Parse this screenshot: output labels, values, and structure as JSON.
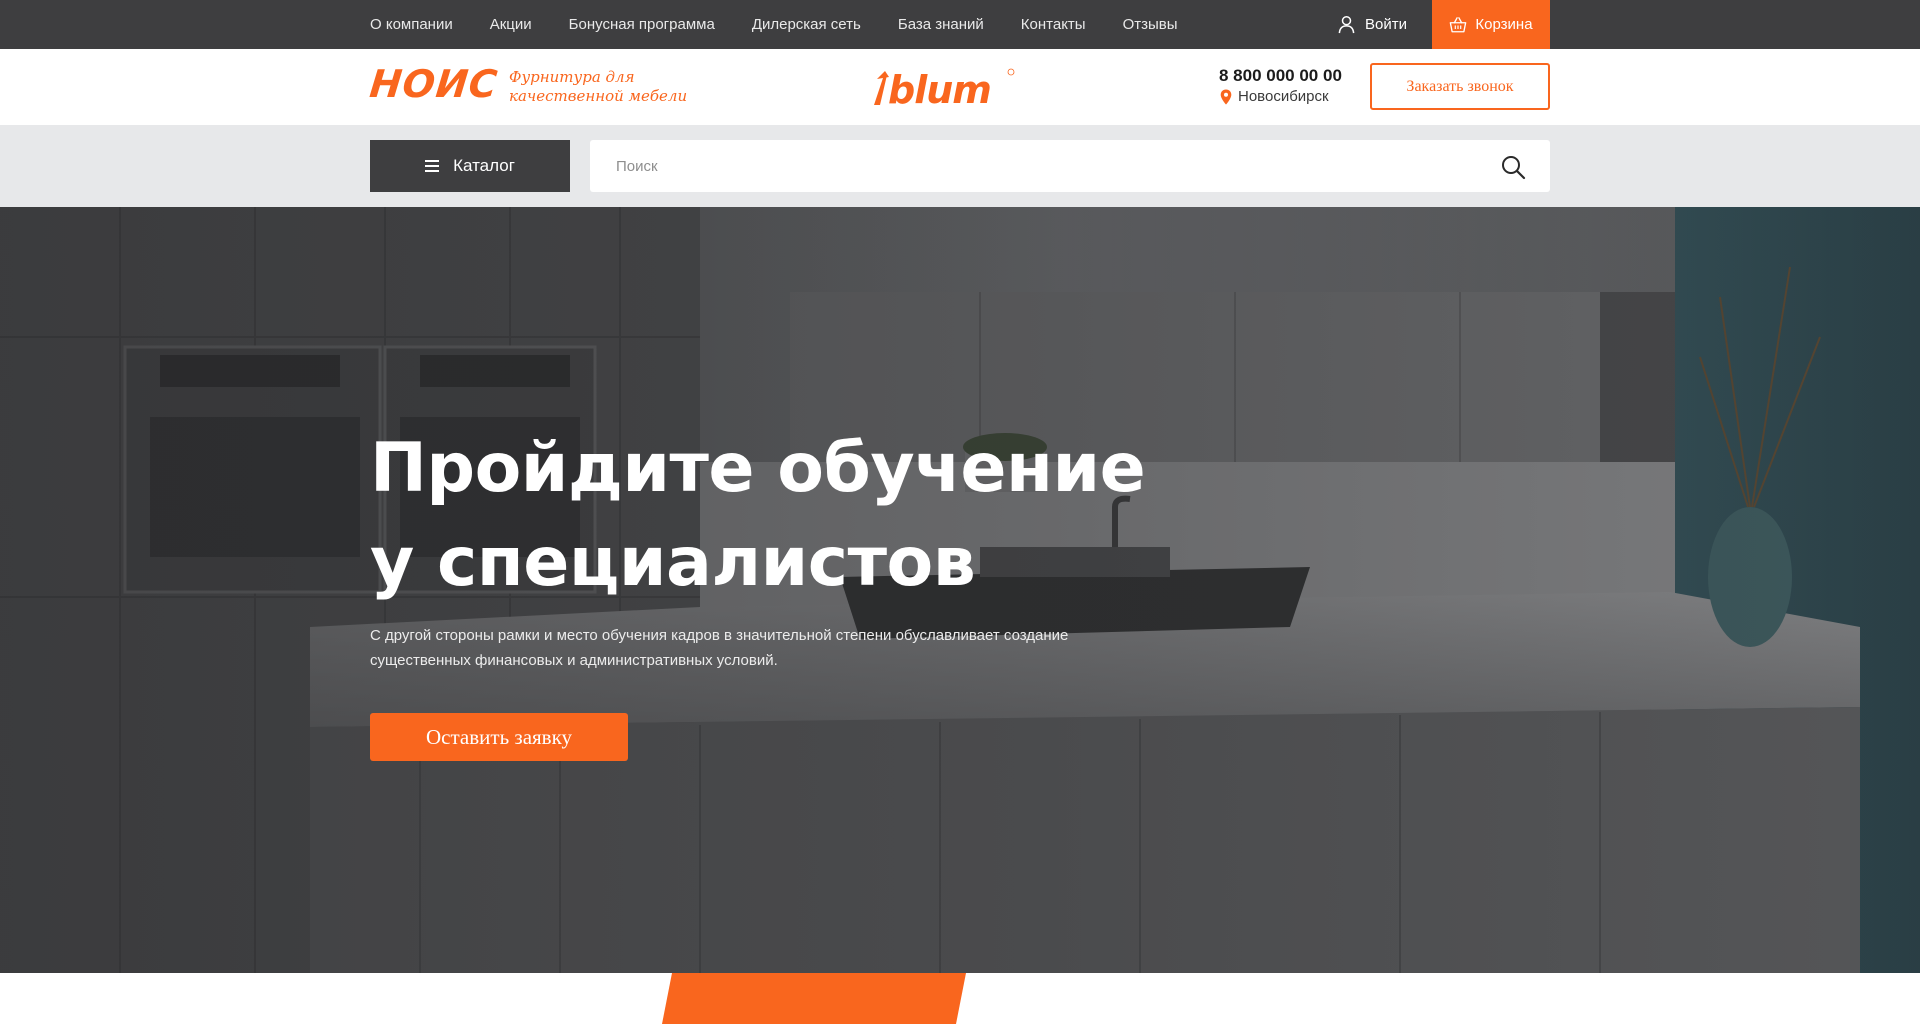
{
  "topbar": {
    "nav": [
      "О компании",
      "Акции",
      "Бонусная программа",
      "Дилерская сеть",
      "База знаний",
      "Контакты",
      "Отзывы"
    ],
    "login_label": "Войти",
    "cart_label": "Корзина"
  },
  "header": {
    "logo_text": "НОИС",
    "logo_tagline": "Фурнитура для качественной мебели",
    "brand_logo": "blum",
    "phone": "8 800 000 00 00",
    "city": "Новосибирск",
    "callback_button": "Заказать звонок"
  },
  "searchbar": {
    "catalog_label": "Каталог",
    "search_placeholder": "Поиск"
  },
  "hero": {
    "title_line1": "Пройдите обучение",
    "title_line2": "у специалистов",
    "text": "С другой стороны рамки и место обучения кадров в значительной степени обуславливает создание существенных финансовых и административных условий.",
    "button_label": "Оставить заявку"
  },
  "colors": {
    "accent": "#f9661e",
    "dark": "#3e3e40",
    "band": "#e7e8ea"
  },
  "icons": {
    "login": "user-icon",
    "cart": "basket-icon",
    "location": "map-pin-icon",
    "catalog": "menu-icon",
    "search": "search-icon"
  }
}
